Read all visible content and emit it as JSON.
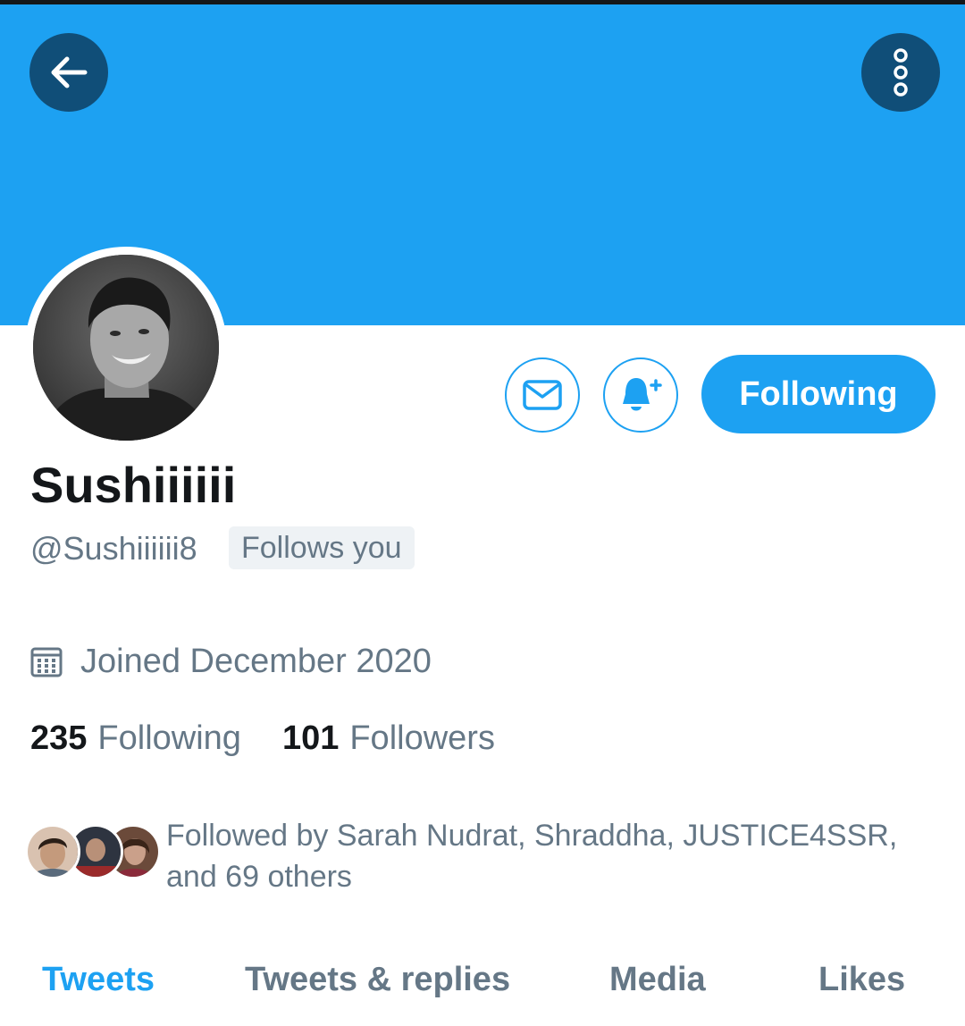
{
  "profile": {
    "display_name": "Sushiiiiii",
    "handle": "@Sushiiiiii8",
    "follows_you_label": "Follows you",
    "joined": "Joined December 2020"
  },
  "actions": {
    "following_label": "Following"
  },
  "stats": {
    "following_count": "235",
    "following_label": "Following",
    "followers_count": "101",
    "followers_label": "Followers"
  },
  "followed_by": {
    "text": "Followed by Sarah Nudrat, Shraddha, JUSTICE4SSR, and 69 others"
  },
  "tabs": [
    {
      "label": "Tweets",
      "active": true
    },
    {
      "label": "Tweets & replies",
      "active": false
    },
    {
      "label": "Media",
      "active": false
    },
    {
      "label": "Likes",
      "active": false
    }
  ],
  "icons": {
    "back": "arrow-left-icon",
    "more": "more-vertical-icon",
    "message": "envelope-icon",
    "notify": "bell-plus-icon",
    "calendar": "calendar-icon"
  },
  "colors": {
    "accent": "#1da1f2",
    "header_button": "#104e78",
    "text_primary": "#14171a",
    "text_secondary": "#657786"
  }
}
